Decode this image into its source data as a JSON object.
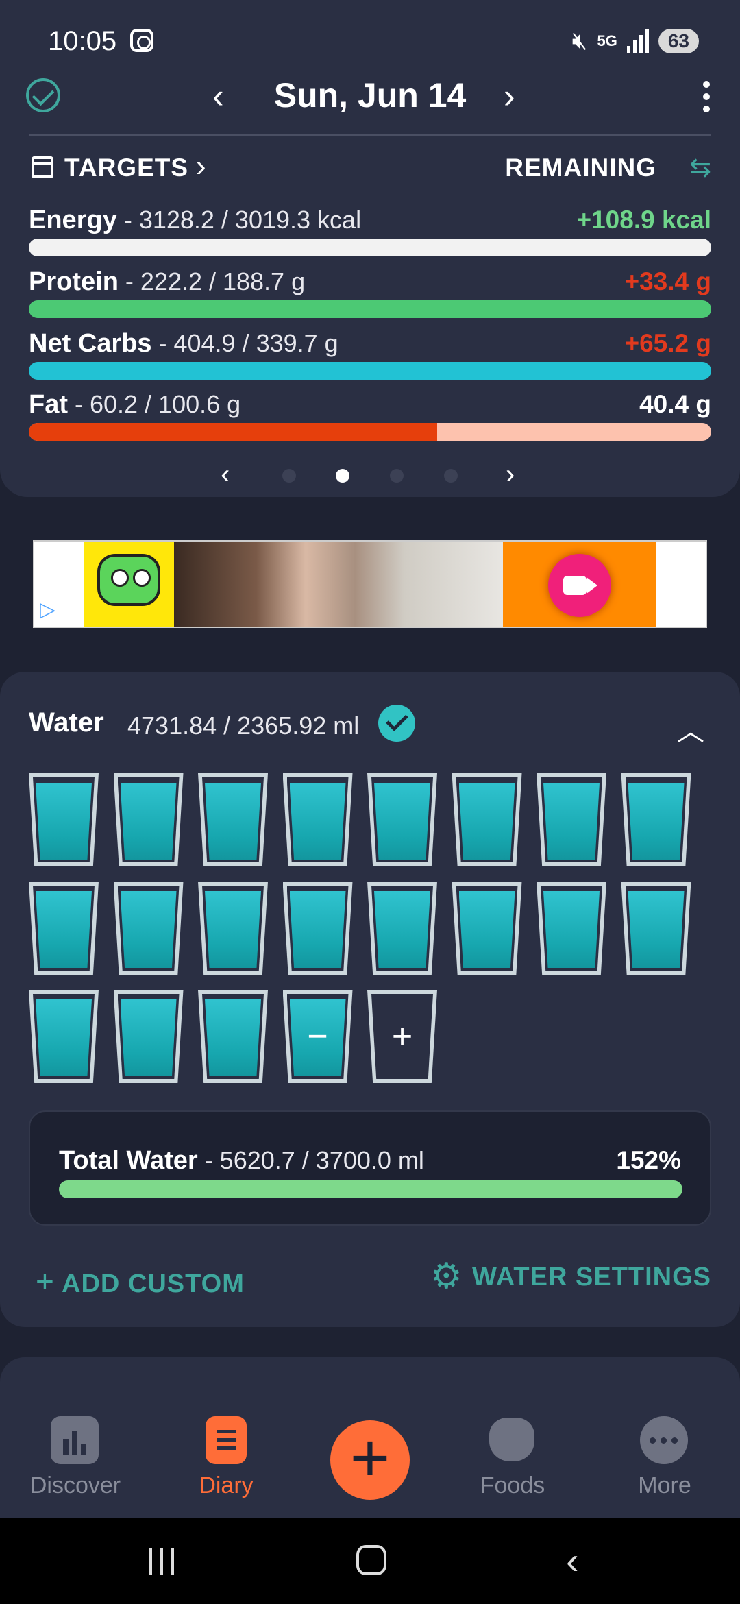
{
  "status_bar": {
    "time": "10:05",
    "network": "5G",
    "battery": "63"
  },
  "header": {
    "date": "Sun, Jun 14"
  },
  "targets": {
    "label": "TARGETS",
    "remaining_label": "REMAINING"
  },
  "macros": [
    {
      "name": "Energy",
      "values": " - 3128.2 / 3019.3 kcal",
      "remaining": "+108.9 kcal",
      "remaining_color": "#6fd58a",
      "fill_fraction": 1.0,
      "bar_color": "#f2f2f2",
      "track_color": "#f2f2f2"
    },
    {
      "name": "Protein",
      "values": " - 222.2 / 188.7 g",
      "remaining": "+33.4 g",
      "remaining_color": "#e23a1e",
      "fill_fraction": 1.0,
      "bar_color": "#4cc974",
      "track_color": "#4cc974"
    },
    {
      "name": "Net Carbs",
      "values": " - 404.9 / 339.7 g",
      "remaining": "+65.2 g",
      "remaining_color": "#e23a1e",
      "fill_fraction": 1.0,
      "bar_color": "#22c2d4",
      "track_color": "#22c2d4"
    },
    {
      "name": "Fat",
      "values": " - 60.2 / 100.6 g",
      "remaining": "40.4 g",
      "remaining_color": "#ffffff",
      "fill_fraction": 0.598,
      "bar_color": "#e63f0c",
      "track_color": "#fdc2ae"
    }
  ],
  "pager": {
    "pages": 4,
    "active": 1
  },
  "ad": {
    "icon": "ad-choices-icon"
  },
  "water": {
    "title": "Water",
    "amount": "4731.84 / 2365.92 ml",
    "full_glasses": 19,
    "minus_label": "−",
    "plus_label": "+",
    "total_name": "Total Water",
    "total_values": " - 5620.7 / 3700.0 ml",
    "total_percent": "152%",
    "total_fill_fraction": 1.0,
    "add_custom": "ADD CUSTOM",
    "settings": "WATER SETTINGS"
  },
  "bottom_nav": {
    "discover": "Discover",
    "diary": "Diary",
    "foods": "Foods",
    "more": "More"
  },
  "colors": {
    "accent": "#3fa79d",
    "fab": "#ff6d38",
    "water": "#22c2d4",
    "total_bar": "#7ed98b"
  }
}
